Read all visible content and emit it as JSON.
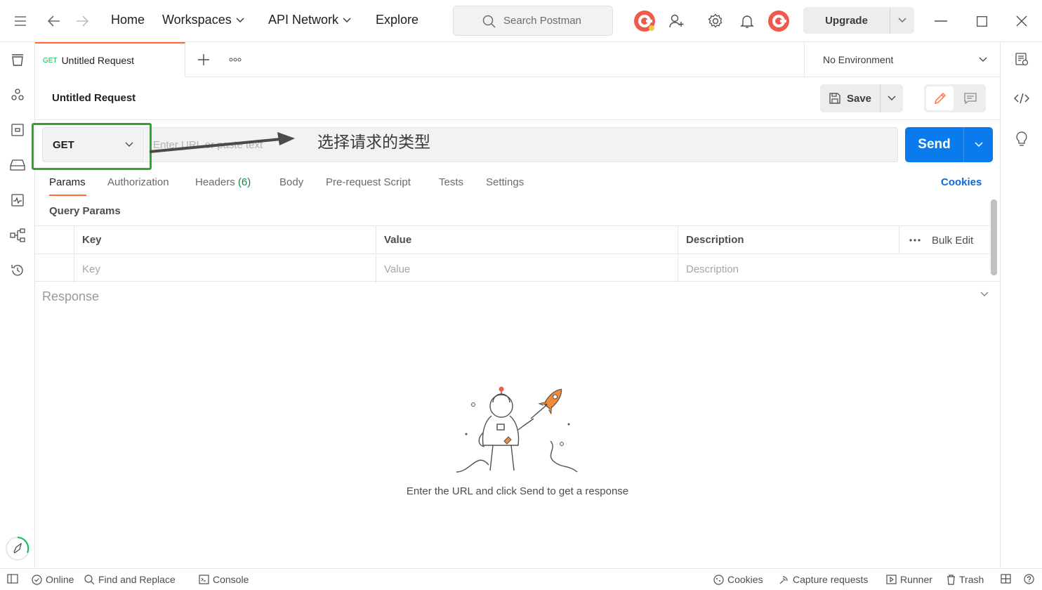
{
  "topbar": {
    "nav": [
      {
        "label": "Home"
      },
      {
        "label": "Workspaces"
      },
      {
        "label": "API Network"
      },
      {
        "label": "Explore"
      }
    ],
    "search_placeholder": "Search Postman",
    "upgrade_label": "Upgrade"
  },
  "tabs": {
    "active": {
      "method": "GET",
      "label": "Untitled Request"
    },
    "environment": "No Environment"
  },
  "request": {
    "title": "Untitled Request",
    "save_label": "Save",
    "method": "GET",
    "url_placeholder": "Enter URL or paste text",
    "send_label": "Send",
    "tabs": [
      {
        "label": "Params"
      },
      {
        "label": "Authorization"
      },
      {
        "label": "Headers",
        "count": "(6)"
      },
      {
        "label": "Body"
      },
      {
        "label": "Pre-request Script"
      },
      {
        "label": "Tests"
      },
      {
        "label": "Settings"
      }
    ],
    "cookies_label": "Cookies",
    "query_params_title": "Query Params",
    "params_table": {
      "headers": [
        "Key",
        "Value",
        "Description"
      ],
      "placeholders": [
        "Key",
        "Value",
        "Description"
      ],
      "bulk_edit_label": "Bulk Edit"
    }
  },
  "annotation": {
    "text": "选择请求的类型",
    "box_color": "#2ea52d"
  },
  "response": {
    "label": "Response",
    "empty_text": "Enter the URL and click Send to get a response"
  },
  "statusbar": {
    "online": "Online",
    "find_replace": "Find and Replace",
    "console": "Console",
    "cookies": "Cookies",
    "capture": "Capture requests",
    "runner": "Runner",
    "trash": "Trash"
  },
  "colors": {
    "accent": "#ff6c37",
    "send_blue": "#097bed",
    "get_green": "#0cbb52",
    "link_blue": "#0b6ad6"
  }
}
